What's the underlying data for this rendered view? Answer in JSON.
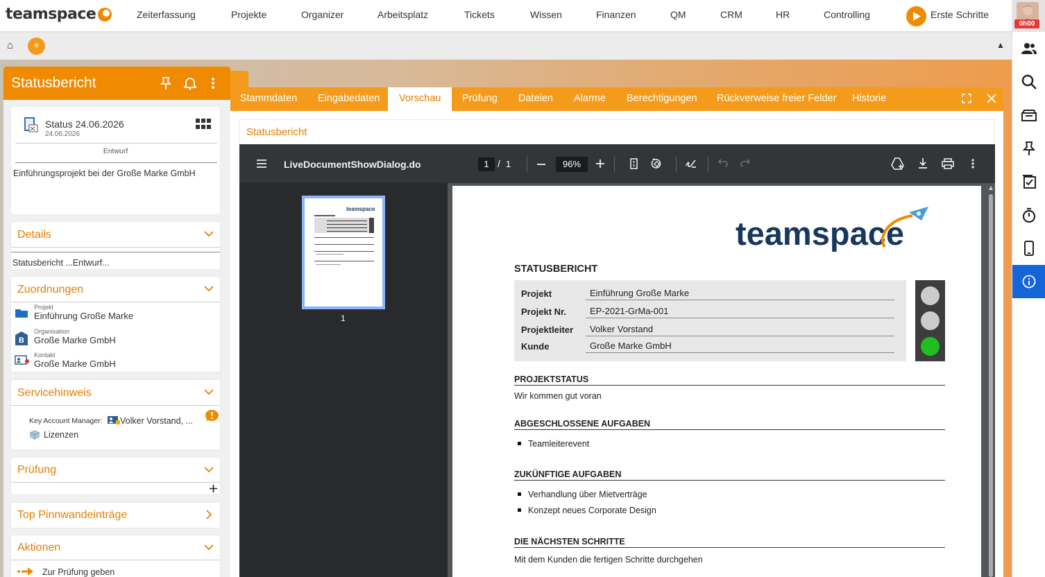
{
  "app": {
    "logo": "teamspace",
    "nav": [
      "Zeiterfassung",
      "Projekte",
      "Organizer",
      "Arbeitsplatz",
      "Tickets",
      "Wissen",
      "Finanzen",
      "QM",
      "CRM",
      "HR",
      "Controlling"
    ],
    "first_steps": "Erste Schritte",
    "timer": "0h00"
  },
  "secondary": {
    "menu_glyph": "≡"
  },
  "left_panel": {
    "title": "Statusbericht",
    "status": {
      "title": "Status 24.06.2026",
      "date": "24.06.2026",
      "state": "Entwurf",
      "description": "Einführungsprojekt bei der Große Marke GmbH"
    },
    "details": {
      "title": "Details",
      "summary": "Statusbericht ...Entwurf..."
    },
    "zuordnungen": {
      "title": "Zuordnungen",
      "items": [
        {
          "type": "Projekt",
          "value": "Einführung Große Marke"
        },
        {
          "type": "Organisation",
          "value": "Große Marke GmbH"
        },
        {
          "type": "Kontakt",
          "value": "Große Marke GmbH"
        }
      ]
    },
    "servicehinweis": {
      "title": "Servicehinweis",
      "kam_label": "Key Account Manager:",
      "kam_value": "Volker Vorstand, ...",
      "lizenzen": "Lizenzen"
    },
    "pruefung": {
      "title": "Prüfung"
    },
    "pinnwand": {
      "title": "Top Pinnwandeinträge"
    },
    "aktionen": {
      "title": "Aktionen",
      "items": [
        "Zur Prüfung geben"
      ]
    }
  },
  "tabs": [
    "Stammdaten",
    "Eingabedaten",
    "Vorschau",
    "Prüfung",
    "Dateien",
    "Alarme",
    "Berechtigungen",
    "Rückverweise freier Felder",
    "Historie"
  ],
  "active_tab": "Vorschau",
  "subtitle": "Statusbericht",
  "viewer": {
    "filename": "LiveDocumentShowDialog.do",
    "page": "1",
    "page_sep": "/",
    "pages": "1",
    "zoom": "96%",
    "thumb_label": "1"
  },
  "document": {
    "logo": "teamspace",
    "title": "STATUSBERICHT",
    "fields": [
      {
        "label": "Projekt",
        "value": "Einführung Große Marke"
      },
      {
        "label": "Projekt Nr.",
        "value": "EP-2021-GrMa-001"
      },
      {
        "label": "Projektleiter",
        "value": "Volker Vorstand"
      },
      {
        "label": "Kunde",
        "value": "Große Marke GmbH"
      }
    ],
    "traffic_light": {
      "red": "#cccccc",
      "yellow": "#cccccc",
      "green": "#1fbf1f"
    },
    "sections": {
      "projektstatus": {
        "title": "PROJEKTSTATUS",
        "text": "Wir kommen gut voran"
      },
      "abgeschlossen": {
        "title": "ABGESCHLOSSENE AUFGABEN",
        "items": [
          "Teamleiterevent"
        ]
      },
      "zukuenftig": {
        "title": "ZUKÜNFTIGE AUFGABEN",
        "items": [
          "Verhandlung über Mietverträge",
          "Konzept neues Corporate Design"
        ]
      },
      "naechste": {
        "title": "DIE NÄCHSTEN SCHRITTE",
        "text": "Mit dem Kunden die fertigen Schritte durchgehen"
      }
    }
  },
  "colors": {
    "accent": "#f08a00",
    "tabbar": "#f49b1c",
    "title_text": "#e67e00",
    "active_sidebar": "#1565d8"
  }
}
